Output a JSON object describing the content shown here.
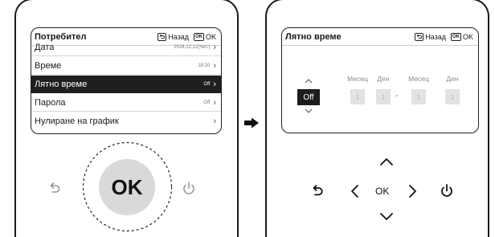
{
  "left_screen": {
    "title": "Потребител",
    "back_label": "Назад",
    "back_icon": "return-icon",
    "ok_key_label": "OK",
    "ok_label": "OK",
    "rows": [
      {
        "label": "Дата",
        "value": "2024,12,12(Чет.)"
      },
      {
        "label": "Време",
        "value": "18:20"
      },
      {
        "label": "Лятно време",
        "value": "Off"
      },
      {
        "label": "Парола",
        "value": "Off"
      },
      {
        "label": "Нулиране на график",
        "value": ""
      }
    ],
    "selected_index": 2
  },
  "left_controls": {
    "center_label": "OK",
    "back_icon": "return-icon",
    "power_icon": "power-icon"
  },
  "transition_arrow": "right-arrow-icon",
  "right_screen": {
    "title": "Лятно време",
    "back_label": "Назад",
    "ok_key_label": "OK",
    "ok_label": "OK",
    "toggle_value": "Off",
    "column_labels": [
      "Месец",
      "Ден",
      "Месец",
      "Ден"
    ],
    "values": [
      "1",
      "1",
      "1",
      "1"
    ],
    "separator": "-"
  },
  "right_controls": {
    "center_label": "OK",
    "up_icon": "chevron-up-icon",
    "down_icon": "chevron-down-icon",
    "left_icon": "chevron-left-icon",
    "right_icon": "chevron-right-icon",
    "back_icon": "return-icon",
    "power_icon": "power-icon"
  },
  "colors": {
    "selected_row": "#1f1f1f",
    "ok_button": "#d9d9d9",
    "disabled_cell": "#e2e2e2"
  }
}
